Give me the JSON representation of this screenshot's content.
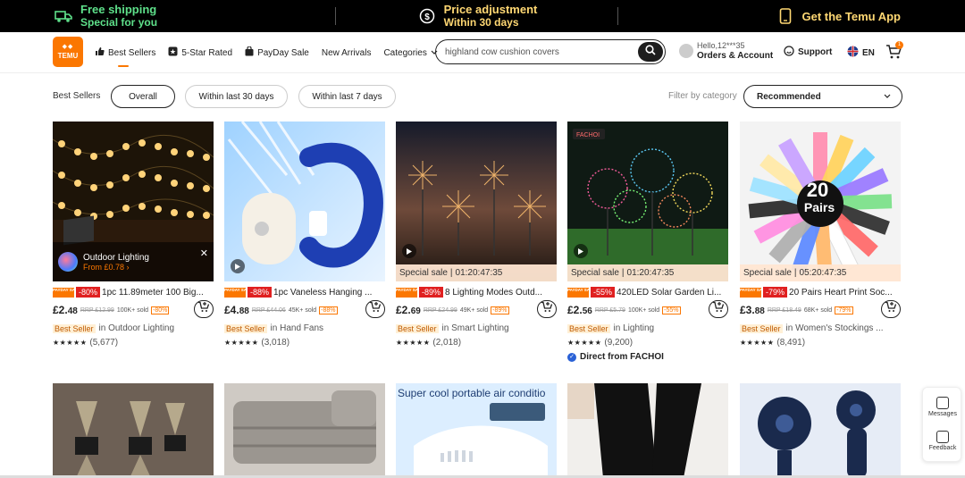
{
  "promo": {
    "left_line1": "Free shipping",
    "left_line2": "Special for you",
    "center_line1": "Price adjustment",
    "center_line2": "Within 30 days",
    "right_text": "Get the Temu App"
  },
  "header": {
    "logo_text": "TEMU",
    "nav": [
      "Best Sellers",
      "5-Star Rated",
      "PayDay Sale",
      "New Arrivals",
      "Categories"
    ],
    "search_value": "highland cow cushion covers",
    "account_greeting": "Hello,12***35",
    "account_label": "Orders & Account",
    "support_label": "Support",
    "lang_label": "EN",
    "cart_count": "1"
  },
  "filters": {
    "label": "Best Sellers",
    "pills": [
      "Overall",
      "Within last 30 days",
      "Within last 7 days"
    ],
    "filter_label": "Filter by category",
    "sort_value": "Recommended"
  },
  "overlay": {
    "title": "Outdoor Lighting",
    "price": "From £0.78 ›"
  },
  "products": [
    {
      "payday_label": "PAYDAY SALE",
      "discount": "-80%",
      "title": "1pc 11.89meter 100 Big...",
      "price_int": "£2.",
      "price_dec": "48",
      "rrp": "RRP £12.99",
      "sold": "100K+ sold",
      "disc_small": "-80%",
      "best_seller": "Best Seller",
      "category": "in Outdoor Lighting",
      "stars": "★★★★★",
      "rating_count": "(5,677)",
      "timer": ""
    },
    {
      "payday_label": "PAYDAY SALE",
      "discount": "-88%",
      "title": "1pc Vaneless Hanging ...",
      "price_int": "£4.",
      "price_dec": "88",
      "rrp": "RRP £44.06",
      "sold": "45K+ sold",
      "disc_small": "-88%",
      "best_seller": "Best Seller",
      "category": "in Hand Fans",
      "stars": "★★★★★",
      "rating_count": "(3,018)",
      "timer": ""
    },
    {
      "payday_label": "PAYDAY SALE",
      "discount": "-89%",
      "title": "8 Lighting Modes Outd...",
      "price_int": "£2.",
      "price_dec": "69",
      "rrp": "RRP £24.99",
      "sold": "49K+ sold",
      "disc_small": "-89%",
      "best_seller": "Best Seller",
      "category": "in Smart Lighting",
      "stars": "★★★★★",
      "rating_count": "(2,018)",
      "timer_label": "Special sale",
      "timer": "01:20:47:35"
    },
    {
      "payday_label": "PAYDAY SALE",
      "discount": "-55%",
      "title": "420LED Solar Garden Li...",
      "price_int": "£2.",
      "price_dec": "56",
      "rrp": "RRP £5.79",
      "sold": "100K+ sold",
      "disc_small": "-55%",
      "best_seller": "Best Seller",
      "category": "in Lighting",
      "stars": "★★★★★",
      "rating_count": "(9,200)",
      "timer_label": "Special sale",
      "timer": "01:20:47:35",
      "direct": "Direct from FACHOI",
      "badge_text": "FACHOI"
    },
    {
      "payday_label": "PAYDAY SALE",
      "discount": "-79%",
      "title": "20 Pairs Heart Print Soc...",
      "price_int": "£3.",
      "price_dec": "88",
      "rrp": "RRP £18.49",
      "sold": "68K+ sold",
      "disc_small": "-79%",
      "best_seller": "Best Seller",
      "category": "in Women's Stockings ...",
      "stars": "★★★★★",
      "rating_count": "(8,491)",
      "timer_label": "Special sale",
      "timer": "05:20:47:35",
      "badge_big": "20",
      "badge_small": "Pairs"
    }
  ],
  "row2": {
    "ad_text": "Super cool portable air conditio"
  },
  "side": {
    "messages": "Messages",
    "feedback": "Feedback"
  },
  "colors": {
    "accent": "#fb7701",
    "promo_bg": "#000000",
    "free_shipping": "#5ee08a",
    "price_adjust": "#ffd873"
  }
}
